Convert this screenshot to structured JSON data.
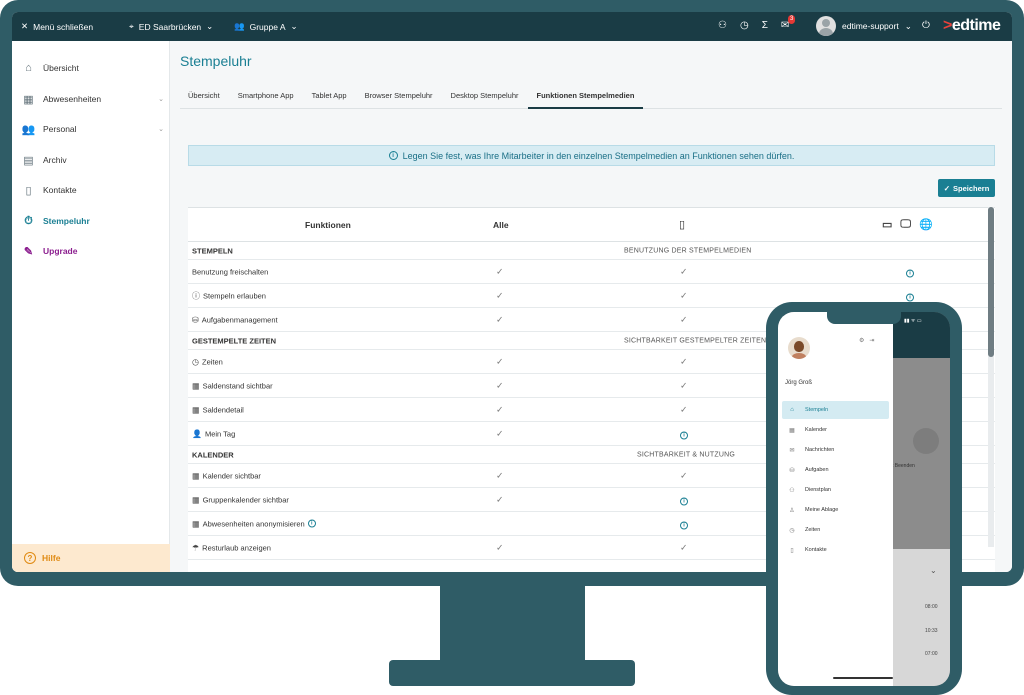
{
  "topbar": {
    "close_menu": "Menü schließen",
    "location": "ED Saarbrücken",
    "group": "Gruppe A",
    "mail_badge": "3",
    "user": "edtime-support",
    "logo_mark": ">",
    "logo_text": "edtime"
  },
  "sidebar": {
    "items": [
      {
        "label": "Übersicht",
        "icon": "home-icon"
      },
      {
        "label": "Abwesenheiten",
        "icon": "calendar-icon"
      },
      {
        "label": "Personal",
        "icon": "people-icon"
      },
      {
        "label": "Archiv",
        "icon": "archive-icon"
      },
      {
        "label": "Kontakte",
        "icon": "contacts-icon"
      },
      {
        "label": "Stempeluhr",
        "icon": "stopwatch-icon"
      },
      {
        "label": "Upgrade",
        "icon": "magic-wand-icon"
      }
    ],
    "help": "Hilfe"
  },
  "main": {
    "title": "Stempeluhr",
    "tabs": [
      "Übersicht",
      "Smartphone App",
      "Tablet App",
      "Browser Stempeluhr",
      "Desktop Stempeluhr",
      "Funktionen Stempelmedien"
    ],
    "active_tab": 5,
    "info": "Legen Sie fest, was Ihre Mitarbeiter in den einzelnen Stempelmedien an Funktionen sehen dürfen.",
    "save": "Speichern",
    "table": {
      "col_functions": "Funktionen",
      "col_all": "Alle",
      "sections": [
        {
          "title": "STEMPELN",
          "subtitle": "BENUTZUNG DER STEMPELMEDIEN"
        },
        {
          "title": "GESTEMPELTE ZEITEN",
          "subtitle": "SICHTBARKEIT GESTEMPELTER ZEITEN"
        },
        {
          "title": "KALENDER",
          "subtitle": "SICHTBARKEIT & NUTZUNG"
        }
      ],
      "rows": [
        {
          "label": "Benutzung freischalten"
        },
        {
          "label": "Stempeln erlauben"
        },
        {
          "label": "Aufgabenmanagement"
        },
        {
          "label": "Zeiten"
        },
        {
          "label": "Saldenstand sichtbar"
        },
        {
          "label": "Saldendetail"
        },
        {
          "label": "Mein Tag"
        },
        {
          "label": "Kalender sichtbar"
        },
        {
          "label": "Gruppenkalender sichtbar"
        },
        {
          "label": "Abwesenheiten anonymisieren"
        },
        {
          "label": "Resturlaub anzeigen"
        }
      ]
    }
  },
  "phone": {
    "user": "Jörg Groß",
    "menu": [
      "Stempeln",
      "Kalender",
      "Nachrichten",
      "Aufgaben",
      "Dienstplan",
      "Meine Ablage",
      "Zeiten",
      "Kontakte"
    ],
    "bg_label": "t Beenden",
    "times": [
      "08:00",
      "10:33",
      "07:00"
    ]
  }
}
